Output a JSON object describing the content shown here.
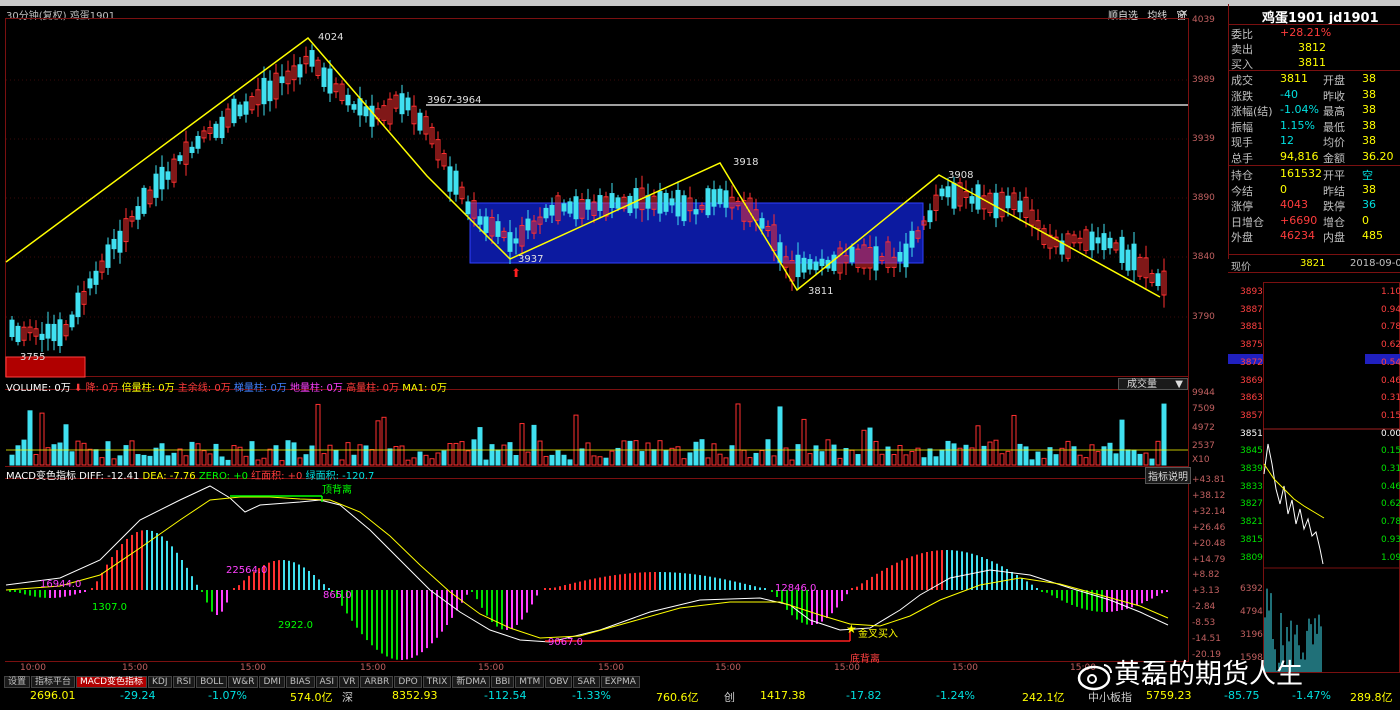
{
  "window": {
    "chart_title": "30分钟(复权)  鸡蛋1901"
  },
  "toolbar": {
    "items": [
      "顺自选",
      "均线",
      "窗"
    ]
  },
  "price_chart": {
    "y_labels": [
      "4039",
      "3989",
      "3939",
      "3890",
      "3840",
      "3790"
    ],
    "annotations": {
      "high": "4024",
      "range": "3967-3964",
      "low_left": "3755",
      "p3937": "3937",
      "p3918": "3918",
      "p3811": "3811",
      "p3908": "3908"
    }
  },
  "volume": {
    "label": "VOLUME: 0万",
    "items": [
      "降: 0万",
      "倍量柱: 0万",
      "主余线: 0万",
      "梯量柱: 0万",
      "地量柱: 0万",
      "高量柱: 0万",
      "MA1: 0万"
    ],
    "selector": "成交量",
    "y_labels": [
      "9944",
      "7509",
      "4972",
      "2537",
      "X10"
    ],
    "bar_tag": "高"
  },
  "macd": {
    "label": "MACD变色指标",
    "diff": "DIFF: -12.41",
    "dea": "DEA: -7.76",
    "zero": "ZERO: +0",
    "red_area": "红面积: +0",
    "green_area": "绿面积: -120.7",
    "explain": "指标说明",
    "annotations": {
      "top_div": "顶背离",
      "bottom_div": "底背离",
      "golden": "金叉买入",
      "a1": "16944.0",
      "a2": "1307.0",
      "a3": "22564.0",
      "a4": "2922.0",
      "a5": "865.0",
      "a6": "12846.0",
      "a7": "9067.0"
    },
    "y_labels": [
      "+43.81",
      "+38.12",
      "+32.14",
      "+26.46",
      "+20.48",
      "+14.79",
      "+8.82",
      "+3.13",
      "-2.84",
      "-8.53",
      "-14.51",
      "-20.19"
    ]
  },
  "x_axis": {
    "labels": [
      "10:00",
      "15:00",
      "15:00",
      "15:00",
      "15:00",
      "15:00",
      "15:00",
      "15:00",
      "15:00",
      "15:00"
    ]
  },
  "tabs": [
    "设置",
    "指标平台",
    "MACD变色指标",
    "KDJ",
    "RSI",
    "BOLL",
    "W&R",
    "DMI",
    "BIAS",
    "ASI",
    "VR",
    "ARBR",
    "DPO",
    "TRIX",
    "新DMA",
    "BBI",
    "MTM",
    "OBV",
    "SAR",
    "EXPMA"
  ],
  "active_tab": "MACD变色指标",
  "statusbar": {
    "v1": "2696.01",
    "c1": "-29.24",
    "p1": "-1.07%",
    "a1": "574.0亿",
    "n2": "深",
    "v2": "8352.93",
    "c2": "-112.54",
    "p2": "-1.33%",
    "a2": "760.6亿",
    "n3": "创",
    "v3": "1417.38",
    "c3": "-17.82",
    "p3": "-1.24%",
    "a3": "242.1亿",
    "n4": "中小板指",
    "v4": "5759.23",
    "c4": "-85.75",
    "p4": "-1.47%",
    "a4": "289.8亿"
  },
  "quote": {
    "title": "鸡蛋1901 jd1901",
    "wei_bi_label": "委比",
    "wei_bi": "+28.21%",
    "sell_label": "卖出",
    "sell": "3812",
    "buy_label": "买入",
    "buy": "3811",
    "rows": [
      {
        "l1": "成交",
        "v1": "3811",
        "l2": "开盘",
        "v2": "38"
      },
      {
        "l1": "涨跌",
        "v1": "-40",
        "l2": "昨收",
        "v2": "38"
      },
      {
        "l1": "涨幅(结)",
        "v1": "-1.04%",
        "l2": "最高",
        "v2": "38"
      },
      {
        "l1": "振幅",
        "v1": "1.15%",
        "l2": "最低",
        "v2": "38"
      },
      {
        "l1": "现手",
        "v1": "12",
        "l2": "均价",
        "v2": "38"
      },
      {
        "l1": "总手",
        "v1": "94,816",
        "l2": "金额",
        "v2": "36.20"
      },
      {
        "l1": "持仓",
        "v1": "161532",
        "l2": "开平",
        "v2": "空"
      },
      {
        "l1": "今结",
        "v1": "0",
        "l2": "昨结",
        "v2": "38"
      },
      {
        "l1": "涨停",
        "v1": "4043",
        "l2": "跌停",
        "v2": "36"
      },
      {
        "l1": "日增仓",
        "v1": "+6690",
        "l2": "增仓",
        "v2": "0"
      },
      {
        "l1": "外盘",
        "v1": "46234",
        "l2": "内盘",
        "v2": "485"
      }
    ],
    "now_label": "现价",
    "now": "3821",
    "date": "2018-09-03"
  },
  "mini_chart": {
    "y_left": [
      "3893",
      "3887",
      "3881",
      "3875",
      "3872",
      "3869",
      "3863",
      "3857",
      "3851",
      "3845",
      "3839",
      "3833",
      "3827",
      "3821",
      "3815",
      "3809",
      "6392",
      "4794",
      "3196",
      "1598"
    ],
    "y_right": [
      "1.10",
      "0.94",
      "0.78",
      "0.62",
      "0.54",
      "0.46",
      "0.31",
      "0.15",
      "0.00",
      "0.15",
      "0.31",
      "0.46",
      "0.62",
      "0.78",
      "0.93",
      "1.09"
    ]
  },
  "watermark": "黄磊的期货人生"
}
